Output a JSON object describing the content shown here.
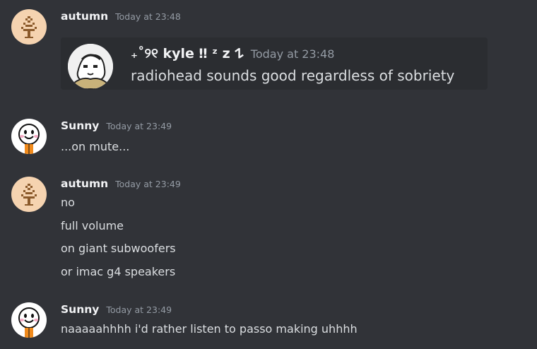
{
  "messages": [
    {
      "author": "autumn",
      "timestamp": "Today at 23:48",
      "avatar_icon": "tree-pixel-icon",
      "embed": {
        "author": "₊˚୨୧ kyle ‼ ᶻ z 𐰁",
        "timestamp": "Today at 23:48",
        "text": "radiohead sounds good regardless of sobriety",
        "avatar_icon": "cartoon-avatar-icon"
      }
    },
    {
      "author": "Sunny",
      "timestamp": "Today at 23:49",
      "avatar_icon": "smiley-face-icon",
      "lines": [
        "...on mute..."
      ]
    },
    {
      "author": "autumn",
      "timestamp": "Today at 23:49",
      "avatar_icon": "tree-pixel-icon",
      "lines": [
        "no",
        "full volume",
        "on giant subwoofers",
        "or imac g4 speakers"
      ]
    },
    {
      "author": "Sunny",
      "timestamp": "Today at 23:49",
      "avatar_icon": "smiley-face-icon",
      "lines": [
        "naaaaahhhh i'd rather listen to passo making uhhhh"
      ]
    }
  ],
  "colors": {
    "background": "#313338",
    "embed_background": "#2b2d31",
    "username": "#f2f3f5",
    "timestamp": "#949ba4",
    "text": "#dbdee1",
    "autumn_avatar_bg": "#f5d3b0",
    "tree_brown": "#8b5a2b"
  }
}
